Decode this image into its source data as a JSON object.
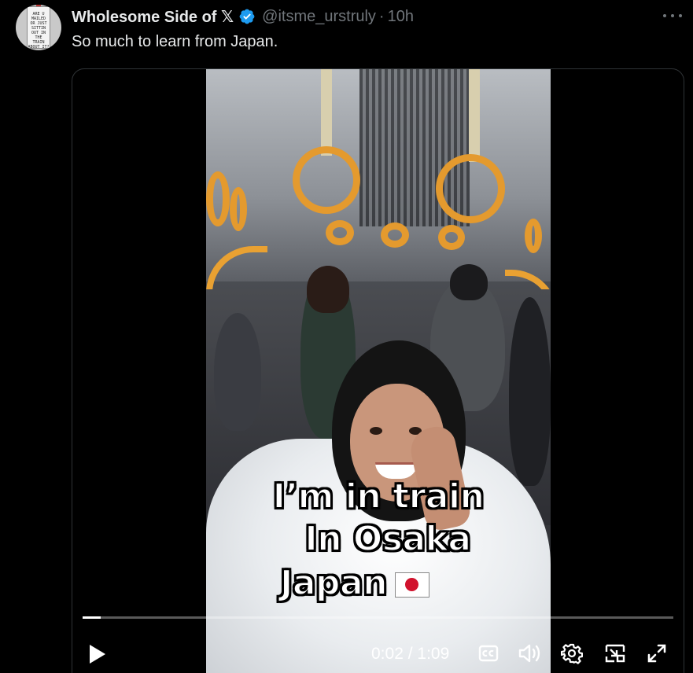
{
  "author": {
    "display_name": "Wholesome Side of 𝕏",
    "handle": "@itsme_urstruly",
    "separator": "·",
    "timestamp": "10h",
    "avatar_sign_text": "ARE U\nMAILED\nOR JUST\nSITTIN\nOUT IN\nTHE\nTRAIN\nABOUT IT?"
  },
  "tweet": {
    "text": "So much to learn from Japan."
  },
  "video": {
    "caption_lines": [
      "I’m in train",
      "In Osaka",
      "Japan"
    ],
    "current_time": "0:02",
    "time_separator": " / ",
    "duration": "1:09",
    "progress_fraction": 0.03
  },
  "icons": {
    "more": "more-horizontal-icon",
    "verified": "verified-badge-icon",
    "play": "play-icon",
    "captions": "cc-icon",
    "volume": "volume-icon",
    "settings": "gear-icon",
    "pip": "picture-in-picture-icon",
    "fullscreen": "fullscreen-icon"
  },
  "colors": {
    "background": "#000000",
    "text_primary": "#e7e9ea",
    "text_secondary": "#71767b",
    "verified_blue": "#1d9bf0",
    "border": "#2f3336"
  }
}
